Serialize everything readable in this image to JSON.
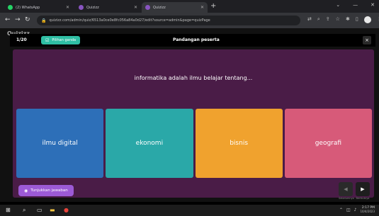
{
  "browser": {
    "tabs": [
      {
        "title": "(2) WhatsApp",
        "icon": "whatsapp-icon",
        "color": "#25d366",
        "active": false
      },
      {
        "title": "Quizizz",
        "icon": "quizizz-icon",
        "color": "#8854c0",
        "active": false
      },
      {
        "title": "Quizizz",
        "icon": "quizizz-icon",
        "color": "#8854c0",
        "active": true
      }
    ],
    "new_tab": "+",
    "url": "quizizz.com/admin/quiz/6513a0ce0e8fc056a84a0d27/edit?source=admin&page=quizPage"
  },
  "app": {
    "logo": "Quizizz",
    "counter": "1/20",
    "question_type": "Pilihan ganda",
    "preview_title": "Pandangan peserta",
    "close": "×",
    "question": "informatika adalah ilmu belajar tentang...",
    "options": [
      "ilmu digital",
      "ekonomi",
      "bisnis",
      "geografi"
    ],
    "option_colors": [
      "#2d6fb8",
      "#2aa8a8",
      "#f0a22e",
      "#d75a79"
    ],
    "show_answer": "Tunjukkan jawaban",
    "prev_label": "Sebelumnya",
    "next_label": "Berikutnya"
  },
  "taskbar": {
    "time": "2:17 PM",
    "date": "10/4/2023"
  }
}
